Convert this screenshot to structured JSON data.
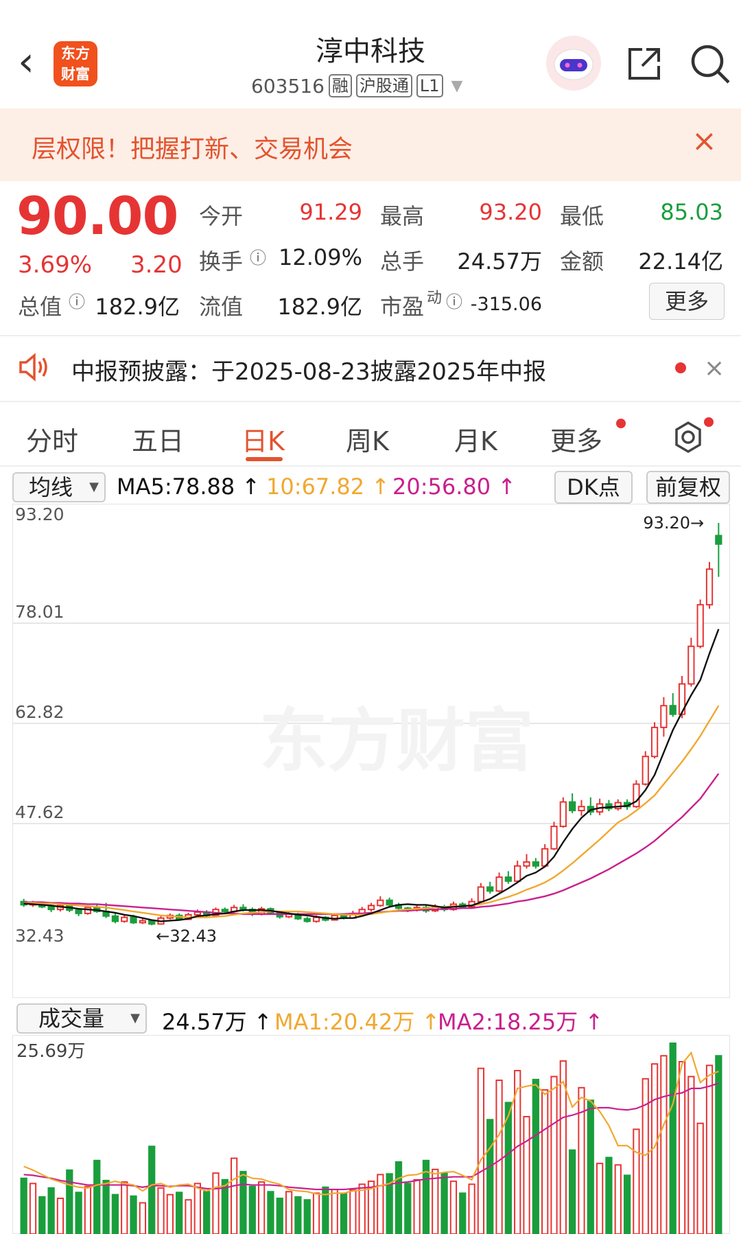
{
  "header": {
    "back_icon": "chevron-left-icon",
    "logo_text_1": "东方",
    "logo_text_2": "财富",
    "title": "淳中科技",
    "code": "603516",
    "tags": [
      "融",
      "沪股通",
      "L1"
    ]
  },
  "banner": {
    "text": "层权限！把握打新、交易机会",
    "close": "×"
  },
  "quote": {
    "price": "90.00",
    "pct": "3.69%",
    "change": "3.20",
    "more_label": "更多",
    "fields": [
      {
        "label": "今开",
        "value": "91.29",
        "color": "red"
      },
      {
        "label": "最高",
        "value": "93.20",
        "color": "red"
      },
      {
        "label": "最低",
        "value": "85.03",
        "color": "green"
      },
      {
        "label": "换手",
        "value": "12.09%",
        "color": "dark"
      },
      {
        "label": "总手",
        "value": "24.57万",
        "color": "dark"
      },
      {
        "label": "金额",
        "value": "22.14亿",
        "color": "dark"
      },
      {
        "label": "总值",
        "value": "182.9亿",
        "color": "dark"
      },
      {
        "label": "流值",
        "value": "182.9亿",
        "color": "dark"
      },
      {
        "label": "市盈",
        "sup": "动",
        "value": "-315.06",
        "color": "dark"
      }
    ]
  },
  "notice": {
    "text": "中报预披露：于2025-08-23披露2025年中报",
    "close": "×"
  },
  "tabs": [
    "分时",
    "五日",
    "日K",
    "周K",
    "月K",
    "更多"
  ],
  "active_tab": "日K",
  "ma_bar": {
    "selector": "均线",
    "ma5": "MA5:78.88",
    "ma10": "10:67.82",
    "ma20": "20:56.80",
    "arrow": "↑",
    "dk_label": "DK点",
    "fq_label": "前复权"
  },
  "vol_bar": {
    "selector": "成交量",
    "vol": "24.57万",
    "ma1": "MA1:20.42万",
    "ma2": "MA2:18.25万",
    "arrow": "↑"
  },
  "colors": {
    "up": "#e63434",
    "down": "#1a9e3d",
    "accent": "#e2542e",
    "ma5": "#111111",
    "ma10": "#f0a830",
    "ma20": "#c8208e"
  },
  "chart_data": {
    "type": "candlestick",
    "y_ticks": [
      "93.20",
      "78.01",
      "62.82",
      "47.62",
      "32.43"
    ],
    "ylim": [
      32.43,
      93.2
    ],
    "high_label": "93.20",
    "low_label": "32.43",
    "watermark": "东方财富",
    "candles": [
      [
        35.8,
        35.3,
        36.2,
        35.0
      ],
      [
        35.3,
        35.6,
        35.9,
        35.0
      ],
      [
        35.6,
        35.0,
        35.8,
        34.8
      ],
      [
        35.0,
        34.6,
        35.2,
        34.2
      ],
      [
        34.6,
        35.2,
        35.5,
        34.3
      ],
      [
        35.2,
        34.5,
        35.4,
        34.2
      ],
      [
        34.5,
        34.0,
        34.8,
        33.6
      ],
      [
        34.0,
        34.9,
        35.2,
        33.8
      ],
      [
        34.9,
        34.3,
        35.3,
        34.1
      ],
      [
        34.3,
        33.6,
        35.6,
        33.3
      ],
      [
        33.6,
        32.8,
        34.0,
        32.5
      ],
      [
        32.8,
        33.4,
        33.7,
        32.6
      ],
      [
        33.4,
        32.6,
        33.8,
        32.4
      ],
      [
        32.6,
        32.9,
        33.2,
        32.4
      ],
      [
        32.9,
        32.4,
        33.1,
        32.2
      ],
      [
        32.4,
        33.3,
        33.6,
        32.3
      ],
      [
        33.3,
        33.7,
        34.0,
        33.1
      ],
      [
        33.7,
        33.1,
        34.0,
        32.9
      ],
      [
        33.1,
        33.8,
        34.1,
        33.0
      ],
      [
        33.8,
        34.2,
        34.6,
        33.6
      ],
      [
        34.2,
        33.7,
        34.5,
        33.5
      ],
      [
        33.7,
        34.6,
        34.9,
        33.6
      ],
      [
        34.6,
        34.3,
        34.9,
        34.0
      ],
      [
        34.3,
        34.9,
        35.3,
        34.1
      ],
      [
        34.9,
        34.6,
        35.4,
        34.3
      ],
      [
        34.6,
        33.9,
        34.9,
        33.6
      ],
      [
        33.9,
        34.7,
        35.0,
        33.7
      ],
      [
        34.7,
        34.1,
        34.9,
        33.9
      ],
      [
        34.1,
        33.5,
        34.3,
        33.2
      ],
      [
        33.5,
        33.9,
        34.2,
        33.3
      ],
      [
        33.9,
        33.2,
        34.1,
        33.0
      ],
      [
        33.2,
        32.8,
        33.5,
        32.6
      ],
      [
        32.8,
        33.4,
        33.7,
        32.6
      ],
      [
        33.4,
        33.0,
        33.6,
        32.8
      ],
      [
        33.0,
        33.7,
        34.0,
        32.9
      ],
      [
        33.7,
        33.3,
        34.0,
        33.1
      ],
      [
        33.3,
        34.0,
        34.4,
        33.2
      ],
      [
        34.0,
        34.6,
        35.0,
        33.8
      ],
      [
        34.6,
        35.2,
        35.6,
        34.3
      ],
      [
        35.2,
        36.0,
        36.6,
        35.0
      ],
      [
        36.0,
        35.3,
        36.4,
        35.0
      ],
      [
        35.3,
        34.8,
        35.6,
        34.5
      ],
      [
        34.8,
        34.5,
        35.0,
        34.2
      ],
      [
        34.5,
        34.9,
        35.2,
        34.3
      ],
      [
        34.9,
        34.4,
        35.2,
        34.1
      ],
      [
        34.4,
        35.0,
        35.4,
        34.2
      ],
      [
        35.0,
        34.6,
        35.3,
        34.3
      ],
      [
        34.6,
        35.4,
        35.8,
        34.4
      ],
      [
        35.4,
        35.0,
        35.7,
        34.7
      ],
      [
        35.0,
        35.8,
        36.3,
        34.8
      ],
      [
        35.8,
        38.0,
        38.6,
        35.6
      ],
      [
        38.0,
        37.4,
        38.8,
        37.0
      ],
      [
        37.4,
        39.5,
        40.2,
        37.2
      ],
      [
        39.5,
        38.9,
        40.4,
        38.5
      ],
      [
        38.9,
        41.2,
        42.0,
        38.7
      ],
      [
        41.2,
        41.8,
        43.0,
        40.8
      ],
      [
        41.8,
        41.2,
        42.4,
        40.8
      ],
      [
        41.2,
        43.8,
        44.5,
        41.0
      ],
      [
        43.8,
        47.2,
        47.9,
        43.6
      ],
      [
        47.2,
        50.9,
        51.6,
        47.0
      ],
      [
        50.9,
        49.6,
        52.2,
        49.2
      ],
      [
        49.6,
        50.2,
        51.2,
        48.8
      ],
      [
        50.2,
        49.4,
        51.6,
        48.9
      ],
      [
        49.4,
        50.6,
        51.4,
        48.9
      ],
      [
        50.6,
        49.9,
        51.2,
        49.5
      ],
      [
        49.9,
        50.8,
        51.3,
        49.6
      ],
      [
        50.8,
        50.2,
        51.3,
        49.7
      ],
      [
        50.2,
        53.6,
        54.2,
        50.0
      ],
      [
        53.6,
        57.8,
        58.6,
        53.4
      ],
      [
        57.8,
        62.2,
        63.0,
        57.5
      ],
      [
        62.2,
        65.5,
        66.8,
        60.8
      ],
      [
        65.5,
        64.2,
        67.4,
        63.8
      ],
      [
        64.2,
        68.8,
        70.0,
        63.6
      ],
      [
        68.8,
        74.5,
        75.8,
        68.4
      ],
      [
        74.5,
        80.8,
        81.6,
        74.2
      ],
      [
        80.8,
        86.2,
        87.3,
        80.2
      ],
      [
        91.29,
        90.0,
        93.2,
        85.03
      ]
    ],
    "ma5": [
      35.5,
      35.4,
      35.3,
      35.2,
      35.0,
      34.9,
      34.7,
      34.6,
      34.5,
      34.3,
      34.1,
      33.8,
      33.6,
      33.3,
      33.0,
      32.8,
      32.9,
      33.0,
      33.2,
      33.6,
      33.7,
      33.9,
      34.0,
      34.3,
      34.5,
      34.5,
      34.5,
      34.4,
      34.2,
      34.0,
      33.8,
      33.7,
      33.5,
      33.3,
      33.2,
      33.3,
      33.3,
      33.6,
      34.0,
      34.5,
      35.0,
      35.3,
      35.4,
      35.3,
      35.3,
      35.1,
      34.9,
      35.0,
      35.1,
      35.2,
      35.7,
      36.2,
      37.0,
      37.8,
      38.7,
      39.7,
      40.2,
      41.1,
      42.6,
      44.8,
      46.8,
      48.5,
      49.7,
      50.0,
      50.1,
      50.2,
      50.3,
      51.0,
      52.7,
      55.0,
      58.4,
      61.8,
      64.5,
      67.1,
      69.4,
      73.4,
      77.1
    ],
    "ma10": [
      35.6,
      35.6,
      35.5,
      35.5,
      35.4,
      35.3,
      35.2,
      35.1,
      35.0,
      34.9,
      34.7,
      34.5,
      34.3,
      34.1,
      33.9,
      33.7,
      33.6,
      33.5,
      33.4,
      33.4,
      33.4,
      33.5,
      33.6,
      33.8,
      34.0,
      34.1,
      34.2,
      34.3,
      34.3,
      34.3,
      34.3,
      34.2,
      34.1,
      34.0,
      33.9,
      33.8,
      33.8,
      33.8,
      33.9,
      34.1,
      34.3,
      34.5,
      34.6,
      34.7,
      34.8,
      34.9,
      35.0,
      35.1,
      35.1,
      35.2,
      35.4,
      35.7,
      36.1,
      36.5,
      37.0,
      37.6,
      38.1,
      38.7,
      39.5,
      40.5,
      41.6,
      42.8,
      44.0,
      45.2,
      46.5,
      47.8,
      48.6,
      49.6,
      50.7,
      51.9,
      53.6,
      55.3,
      57.0,
      58.9,
      60.9,
      63.2,
      65.5
    ],
    "ma20": [
      35.7,
      35.7,
      35.7,
      35.6,
      35.6,
      35.5,
      35.5,
      35.4,
      35.4,
      35.3,
      35.2,
      35.1,
      35.0,
      34.9,
      34.8,
      34.7,
      34.6,
      34.5,
      34.4,
      34.3,
      34.2,
      34.1,
      34.0,
      34.0,
      33.9,
      33.9,
      33.9,
      33.9,
      33.9,
      33.9,
      33.9,
      33.9,
      33.9,
      33.9,
      33.9,
      33.9,
      34.0,
      34.0,
      34.1,
      34.2,
      34.3,
      34.4,
      34.4,
      34.5,
      34.6,
      34.6,
      34.7,
      34.7,
      34.8,
      34.8,
      35.0,
      35.1,
      35.3,
      35.5,
      35.8,
      36.0,
      36.3,
      36.6,
      37.0,
      37.5,
      38.1,
      38.7,
      39.3,
      40.0,
      40.7,
      41.5,
      42.3,
      43.1,
      44.0,
      45.0,
      46.2,
      47.4,
      48.6,
      50.0,
      51.4,
      53.3,
      55.2
    ]
  },
  "volume_data": {
    "type": "bar",
    "y_top_label": "25.69万",
    "ymax": 25.69,
    "values": [
      7.5,
      6.8,
      5.0,
      6.2,
      4.8,
      8.6,
      5.6,
      6.4,
      9.9,
      7.2,
      5.3,
      7.0,
      5.1,
      4.2,
      11.8,
      6.2,
      5.3,
      5.6,
      4.6,
      6.8,
      5.7,
      8.2,
      7.3,
      10.2,
      8.4,
      6.4,
      7.0,
      5.7,
      4.8,
      5.7,
      5.0,
      4.6,
      5.5,
      6.3,
      6.0,
      5.4,
      5.9,
      6.7,
      7.1,
      8.0,
      8.1,
      9.7,
      6.8,
      7.3,
      9.9,
      8.7,
      8.2,
      7.1,
      5.5,
      6.7,
      22.3,
      15.4,
      20.7,
      17.7,
      22.0,
      15.8,
      20.8,
      19.4,
      21.2,
      23.3,
      11.3,
      19.7,
      18.0,
      9.5,
      10.3,
      9.3,
      7.9,
      14.1,
      20.9,
      22.9,
      24.0,
      25.69,
      23.2,
      21.2,
      14.9,
      22.7,
      24.0
    ],
    "ma1": [
      9.1,
      8.6,
      8.0,
      7.4,
      7.0,
      6.6,
      6.3,
      6.2,
      6.6,
      6.8,
      7.1,
      6.8,
      6.6,
      5.8,
      6.6,
      6.8,
      6.3,
      6.6,
      6.7,
      6.2,
      5.8,
      6.3,
      6.5,
      7.4,
      8.0,
      7.5,
      7.4,
      7.0,
      6.7,
      6.0,
      5.8,
      5.7,
      5.4,
      5.3,
      5.5,
      5.5,
      5.8,
      5.9,
      6.1,
      6.5,
      6.8,
      7.5,
      7.9,
      8.0,
      8.4,
      8.1,
      8.3,
      8.4,
      7.9,
      7.3,
      10.0,
      11.6,
      13.4,
      15.9,
      19.6,
      19.9,
      20.1,
      18.8,
      19.6,
      20.5,
      17.1,
      18.4,
      17.9,
      16.5,
      14.6,
      11.9,
      11.9,
      11.0,
      10.6,
      11.7,
      14.7,
      17.5,
      22.9,
      24.4,
      20.4,
      21.4,
      21.9
    ],
    "ma2": [
      8.0,
      7.9,
      7.7,
      7.5,
      7.2,
      7.0,
      6.8,
      6.6,
      6.6,
      6.6,
      6.6,
      6.6,
      6.5,
      6.3,
      6.5,
      6.5,
      6.4,
      6.5,
      6.5,
      6.3,
      6.1,
      6.1,
      6.2,
      6.5,
      6.7,
      6.6,
      6.6,
      6.6,
      6.5,
      6.3,
      6.2,
      6.1,
      6.0,
      6.0,
      6.0,
      6.0,
      6.1,
      6.2,
      6.3,
      6.5,
      6.7,
      6.9,
      7.0,
      7.2,
      7.4,
      7.5,
      7.6,
      7.7,
      7.7,
      7.7,
      8.4,
      9.1,
      9.9,
      10.8,
      11.8,
      12.5,
      13.3,
      14.1,
      14.9,
      15.7,
      16.0,
      16.4,
      16.9,
      17.0,
      17.0,
      16.8,
      16.7,
      16.9,
      17.4,
      18.1,
      18.5,
      18.8,
      19.0,
      19.6,
      19.6,
      19.9,
      20.3
    ]
  }
}
